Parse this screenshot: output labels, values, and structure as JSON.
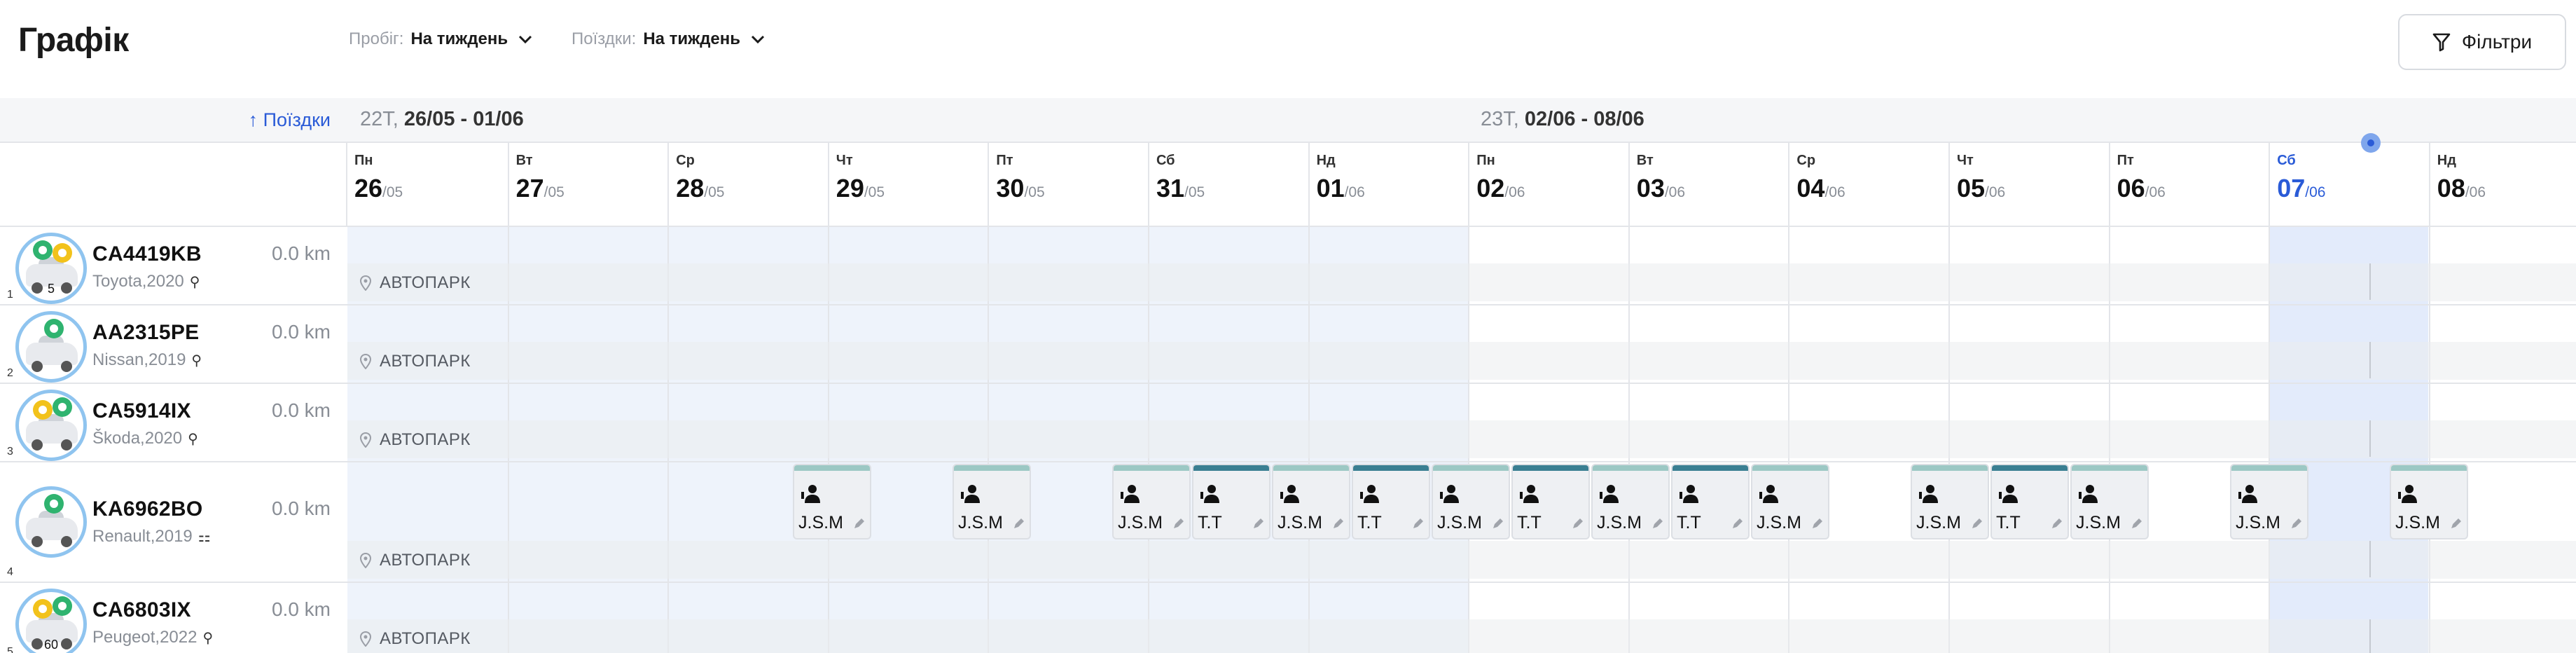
{
  "header": {
    "title": "Графік",
    "mileage": {
      "label": "Пробіг:",
      "value": "На тиждень"
    },
    "trips": {
      "label": "Поїздки:",
      "value": "На тиждень"
    },
    "filters_label": "Фільтри"
  },
  "left": {
    "sort_label": "↑ Поїздки"
  },
  "weeks": [
    {
      "week": "22Т,",
      "range": "26/05 - 01/06"
    },
    {
      "week": "23Т,",
      "range": "02/06 - 08/06"
    }
  ],
  "days": [
    {
      "dn": "Пн",
      "d": "26",
      "m": "/05"
    },
    {
      "dn": "Вт",
      "d": "27",
      "m": "/05"
    },
    {
      "dn": "Ср",
      "d": "28",
      "m": "/05"
    },
    {
      "dn": "Чт",
      "d": "29",
      "m": "/05"
    },
    {
      "dn": "Пт",
      "d": "30",
      "m": "/05"
    },
    {
      "dn": "Сб",
      "d": "31",
      "m": "/05"
    },
    {
      "dn": "Нд",
      "d": "01",
      "m": "/06"
    },
    {
      "dn": "Пн",
      "d": "02",
      "m": "/06"
    },
    {
      "dn": "Вт",
      "d": "03",
      "m": "/06"
    },
    {
      "dn": "Ср",
      "d": "04",
      "m": "/06"
    },
    {
      "dn": "Чт",
      "d": "05",
      "m": "/06"
    },
    {
      "dn": "Пт",
      "d": "06",
      "m": "/06"
    },
    {
      "dn": "Сб",
      "d": "07",
      "m": "/06"
    },
    {
      "dn": "Нд",
      "d": "08",
      "m": "/06"
    }
  ],
  "location_label": "АВТОПАРК",
  "cars": [
    {
      "index": "1",
      "plate": "CA4419KB",
      "model": "Toyota,2020",
      "km": "0.0 km",
      "avatar_count": "5"
    },
    {
      "index": "2",
      "plate": "AA2315PE",
      "model": "Nissan,2019",
      "km": "0.0 km",
      "avatar_count": ""
    },
    {
      "index": "3",
      "plate": "CA5914IX",
      "model": "Škoda,2020",
      "km": "0.0 km",
      "avatar_count": ""
    },
    {
      "index": "4",
      "plate": "KA6962BO",
      "model": "Renault,2019",
      "km": "0.0 km",
      "avatar_count": ""
    },
    {
      "index": "5",
      "plate": "CA6803IX",
      "model": "Peugeot,2022",
      "km": "0.0 km",
      "avatar_count": "60"
    }
  ],
  "trips": [
    {
      "driver": "J.S.M",
      "color": "light"
    },
    {
      "driver": "J.S.M",
      "color": "light"
    },
    {
      "driver": "J.S.M",
      "color": "light"
    },
    {
      "driver": "T.T",
      "color": "teal"
    },
    {
      "driver": "J.S.M",
      "color": "light"
    },
    {
      "driver": "T.T",
      "color": "teal"
    },
    {
      "driver": "J.S.M",
      "color": "light"
    },
    {
      "driver": "T.T",
      "color": "teal"
    },
    {
      "driver": "J.S.M",
      "color": "light"
    },
    {
      "driver": "T.T",
      "color": "teal"
    },
    {
      "driver": "J.S.M",
      "color": "light"
    },
    {
      "driver": "J.S.M",
      "color": "light"
    },
    {
      "driver": "T.T",
      "color": "teal"
    },
    {
      "driver": "J.S.M",
      "color": "light"
    },
    {
      "driver": "J.S.M",
      "color": "light"
    },
    {
      "driver": "J.S.M",
      "color": "light"
    }
  ],
  "colors": {
    "accent": "#2a5bd7",
    "teal": "#3a7f92",
    "light_teal": "#9cc8c4",
    "today_bg": "#e3ebfb",
    "past_bg": "#eef3fb"
  }
}
